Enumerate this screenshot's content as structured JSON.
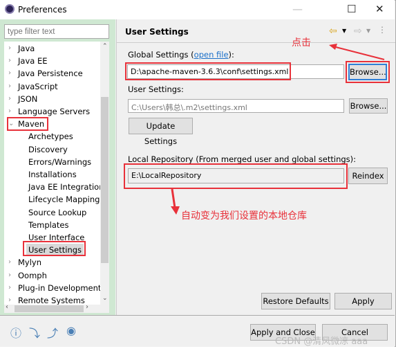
{
  "window": {
    "title": "Preferences",
    "controls": [
      "—",
      "☐",
      "✕"
    ]
  },
  "sidebar": {
    "filter_placeholder": "type filter text",
    "items": [
      {
        "label": "Java",
        "level": 0,
        "state": "collapsed"
      },
      {
        "label": "Java EE",
        "level": 0,
        "state": "collapsed"
      },
      {
        "label": "Java Persistence",
        "level": 0,
        "state": "collapsed"
      },
      {
        "label": "JavaScript",
        "level": 0,
        "state": "collapsed"
      },
      {
        "label": "JSON",
        "level": 0,
        "state": "collapsed"
      },
      {
        "label": "Language Servers",
        "level": 0,
        "state": "collapsed"
      },
      {
        "label": "Maven",
        "level": 0,
        "state": "expanded"
      },
      {
        "label": "Archetypes",
        "level": 1
      },
      {
        "label": "Discovery",
        "level": 1
      },
      {
        "label": "Errors/Warnings",
        "level": 1
      },
      {
        "label": "Installations",
        "level": 1
      },
      {
        "label": "Java EE Integration",
        "level": 1
      },
      {
        "label": "Lifecycle Mappings",
        "level": 1
      },
      {
        "label": "Source Lookup",
        "level": 1
      },
      {
        "label": "Templates",
        "level": 1
      },
      {
        "label": "User Interface",
        "level": 1
      },
      {
        "label": "User Settings",
        "level": 1,
        "selected": true
      },
      {
        "label": "Mylyn",
        "level": 0,
        "state": "collapsed"
      },
      {
        "label": "Oomph",
        "level": 0,
        "state": "collapsed"
      },
      {
        "label": "Plug-in Development",
        "level": 0,
        "state": "collapsed"
      },
      {
        "label": "Remote Systems",
        "level": 0,
        "state": "collapsed"
      }
    ]
  },
  "main": {
    "title": "User Settings",
    "global_label": "Global Settings (",
    "open_file": "open file",
    "global_label_end": "):",
    "global_value": "D:\\apache-maven-3.6.3\\conf\\settings.xml",
    "browse": "Browse...",
    "user_label": "User Settings:",
    "user_value": "C:\\Users\\韩总\\.m2\\settings.xml",
    "update": "Update Settings",
    "local_label": "Local Repository (From merged user and global settings):",
    "local_value": "E:\\LocalRepository",
    "reindex": "Reindex",
    "restore": "Restore Defaults",
    "apply": "Apply"
  },
  "footer": {
    "apply_close": "Apply and Close",
    "cancel": "Cancel"
  },
  "annotations": {
    "click": "点击",
    "auto": "自动变为我们设置的本地仓库",
    "color": "#e8313a"
  },
  "watermark": "CSDN @清风微凉 aaa"
}
